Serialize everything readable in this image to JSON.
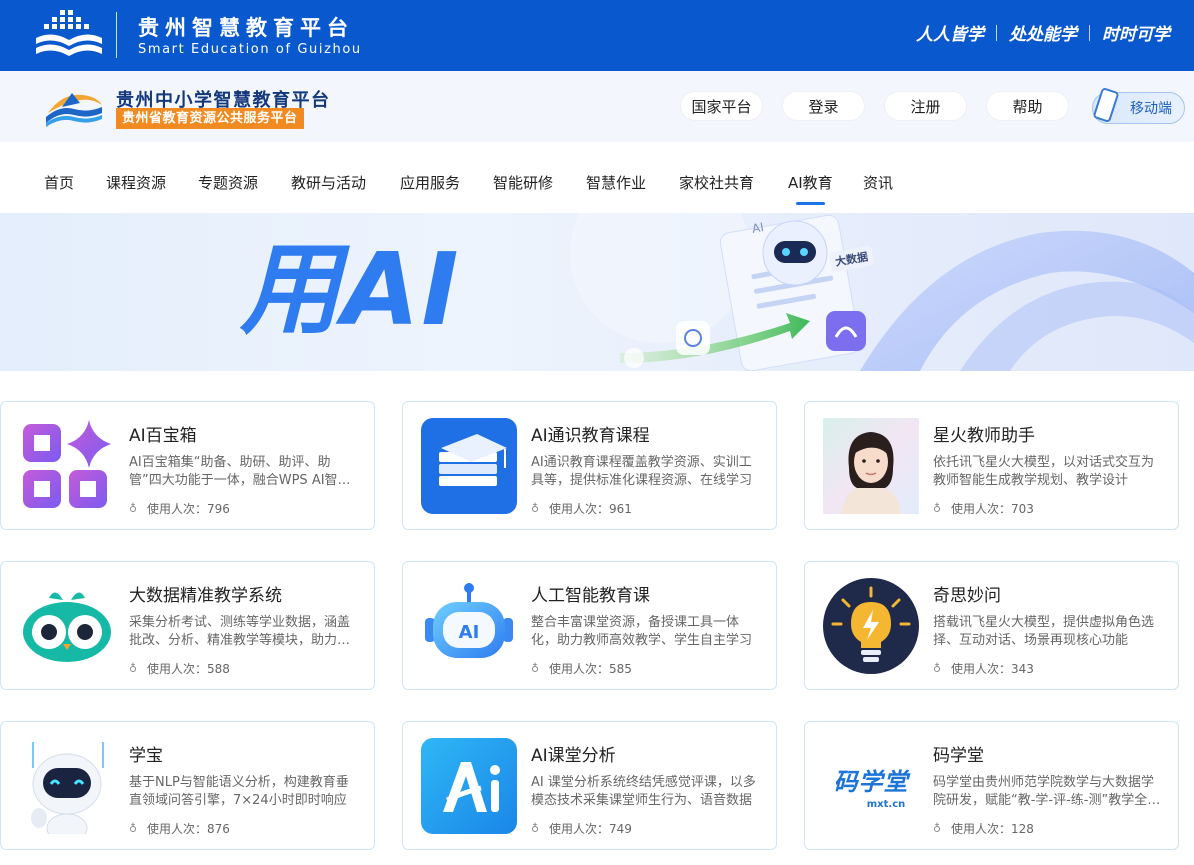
{
  "topbar": {
    "title": "贵州智慧教育平台",
    "subtitle": "Smart Education of Guizhou",
    "slogans": [
      "人人皆学",
      "处处能学",
      "时时可学"
    ],
    "color": "#0a58ce"
  },
  "subheader": {
    "title": "贵州中小学智慧教育平台",
    "badge": "贵州省教育资源公共服务平台",
    "buttons": [
      "国家平台",
      "登录",
      "注册",
      "帮助"
    ],
    "mobile": "移动端"
  },
  "nav": {
    "items": [
      "首页",
      "课程资源",
      "专题资源",
      "教研与活动",
      "应用服务",
      "智能研修",
      "智慧作业",
      "家校社共育",
      "AI教育",
      "资讯"
    ],
    "active": "AI教育"
  },
  "banner": {
    "text": "用AI",
    "tag_ai": "AI",
    "tag_bigdata": "大数据"
  },
  "usage_label": "使用人次：",
  "cards": [
    {
      "title": "AI百宝箱",
      "desc": "AI百宝箱集“助备、助研、助评、助管”四大功能于一体，融合WPS AI智能助手",
      "usage": "796",
      "icon": "grid-sparkle-icon"
    },
    {
      "title": "AI通识教育课程",
      "desc": "AI通识教育课程覆盖教学资源、实训工具等，提供标准化课程资源、在线学习",
      "usage": "961",
      "icon": "books-cap-icon"
    },
    {
      "title": "星火教师助手",
      "desc": "依托讯飞星火大模型，以对话式交互为教师智能生成教学规划、教学设计",
      "usage": "703",
      "icon": "teacher-avatar-icon"
    },
    {
      "title": "大数据精准教学系统",
      "desc": "采集分析考试、测练等学业数据，涵盖批改、分析、精准教学等模块，助力教学",
      "usage": "588",
      "icon": "owl-icon"
    },
    {
      "title": "人工智能教育课",
      "desc": "整合丰富课堂资源，备授课工具一体化，助力教师高效教学、学生自主学习",
      "usage": "585",
      "icon": "ai-robot-icon"
    },
    {
      "title": "奇思妙问",
      "desc": "搭载讯飞星火大模型，提供虚拟角色选择、互动对话、场景再现核心功能",
      "usage": "343",
      "icon": "lightbulb-icon"
    },
    {
      "title": "学宝",
      "desc": "基于NLP与智能语义分析，构建教育垂直领域问答引擎，7×24小时即时响应",
      "usage": "876",
      "icon": "robot-mascot-icon"
    },
    {
      "title": "AI课堂分析",
      "desc": "AI 课堂分析系统终结凭感觉评课，以多模态技术采集课堂师生行为、语音数据",
      "usage": "749",
      "icon": "ai-letters-icon"
    },
    {
      "title": "码学堂",
      "desc": "码学堂由贵州师范学院数学与大数据学院研发，赋能“教-学-评-练-测”教学全流程",
      "usage": "128",
      "icon": "maxuetang-logo-icon",
      "logo_text": "码学堂",
      "logo_url": "mxt.cn"
    }
  ]
}
